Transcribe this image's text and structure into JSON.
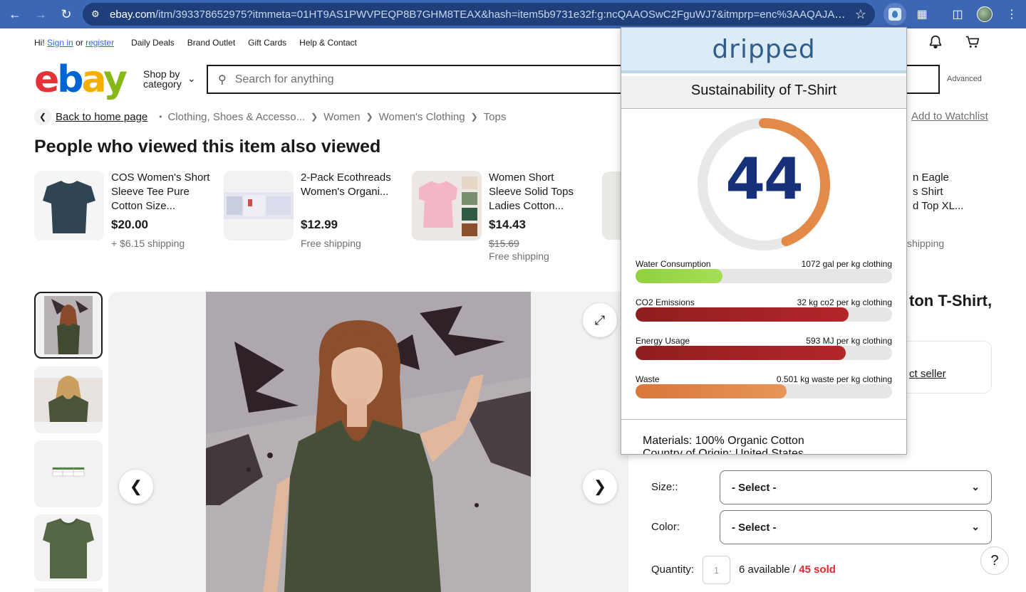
{
  "browser": {
    "url_host": "ebay.com",
    "url_path": "/itm/393378652975?itmmeta=01HT9AS1PWVPEQP8B7GHM8TEAX&hash=item5b9731e32f:g:ncQAAOSwC2FguWJ7&itmprp=enc%3AAQAJAAAA..."
  },
  "topbar": {
    "hi": "Hi!",
    "sign_in": "Sign in",
    "or": "or",
    "register": "register",
    "links": [
      "Daily Deals",
      "Brand Outlet",
      "Gift Cards",
      "Help & Contact"
    ]
  },
  "header": {
    "logo_letters": [
      "e",
      "b",
      "a",
      "y"
    ],
    "shop_by": "Shop by",
    "category": "category",
    "search_placeholder": "Search for anything",
    "advanced": "Advanced"
  },
  "breadcrumb": {
    "back": "Back to home page",
    "items": [
      "Clothing, Shoes & Accesso...",
      "Women",
      "Women's Clothing",
      "Tops"
    ],
    "watchlist": "Add to Watchlist"
  },
  "also_viewed": {
    "title": "People who viewed this item also viewed",
    "cards": [
      {
        "title": "COS Women's Short Sleeve Tee Pure Cotton Size...",
        "price": "$20.00",
        "shipping": "+ $6.15 shipping"
      },
      {
        "title": "2-Pack Ecothreads Women's Organi...",
        "price": "$12.99",
        "shipping": "Free shipping"
      },
      {
        "title": "Women Short Sleeve Solid Tops Ladies Cotton...",
        "price": "$14.43",
        "strike": "$15.69",
        "shipping": "Free shipping"
      }
    ],
    "partial_title": "n Eagle\ns Shirt\nd Top XL...",
    "partial_ship": "shipping"
  },
  "item": {
    "title_partial": "ton T-Shirt,",
    "seller_partial": "ct seller",
    "size_label": "Size::",
    "color_label": "Color:",
    "select_value": "- Select -",
    "quantity_label": "Quantity:",
    "quantity": "1",
    "available": "6 available / ",
    "sold": "45 sold"
  },
  "help": "?",
  "dripped": {
    "logo": "dripped",
    "subtitle": "Sustainability of T-Shirt",
    "score": "44",
    "score_value": 44,
    "metrics": [
      {
        "label": "Water Consumption",
        "value": "1072 gal per kg clothing",
        "fraction": 0.34,
        "color": "#8fd13f",
        "color2": "#a6de55"
      },
      {
        "label": "CO2 Emissions",
        "value": "32 kg co2 per kg clothing",
        "fraction": 0.83,
        "color": "#8f1e1e",
        "color2": "#b3262a"
      },
      {
        "label": "Energy Usage",
        "value": "593 MJ per kg clothing",
        "fraction": 0.82,
        "color": "#8f1e1e",
        "color2": "#b3262a"
      },
      {
        "label": "Waste",
        "value": "0.501 kg waste per kg clothing",
        "fraction": 0.59,
        "color": "#d8773a",
        "color2": "#e8955a"
      }
    ],
    "materials": "Materials: 100% Organic Cotton",
    "origin": "Country of Origin: United States"
  }
}
